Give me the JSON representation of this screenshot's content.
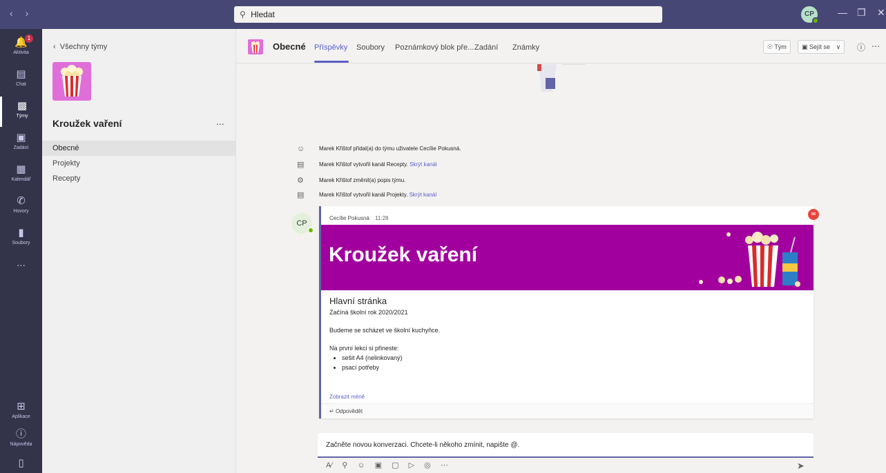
{
  "search": {
    "placeholder": "Hledat"
  },
  "user": {
    "initials": "CP"
  },
  "rail": {
    "notification_count": "1",
    "items": [
      {
        "label": "Aktivita",
        "icon": "bell-icon"
      },
      {
        "label": "Chat",
        "icon": "chat-icon"
      },
      {
        "label": "Týmy",
        "icon": "teams-icon"
      },
      {
        "label": "Zadání",
        "icon": "assignments-icon"
      },
      {
        "label": "Kalendář",
        "icon": "calendar-icon"
      },
      {
        "label": "Hovory",
        "icon": "phone-icon"
      },
      {
        "label": "Soubory",
        "icon": "file-icon"
      }
    ],
    "more": "...",
    "bottom": [
      {
        "label": "Aplikace",
        "icon": "apps-icon"
      },
      {
        "label": "Nápověda",
        "icon": "help-icon"
      }
    ]
  },
  "panel": {
    "back_label": "Všechny týmy",
    "team_name": "Kroužek vaření",
    "more": "...",
    "channels": [
      "Obecné",
      "Projekty",
      "Recepty"
    ]
  },
  "channel": {
    "name": "Obecné",
    "tabs": [
      "Příspěvky",
      "Soubory",
      "Poznámkový blok pře...",
      "Zadání",
      "Známky"
    ],
    "team_btn": "Tým",
    "meet_btn": "Sejít se"
  },
  "events": [
    {
      "icon": "user-add-icon",
      "text": "Marek Křištof přidal(a) do týmu uživatele Cecílie Pokusná.",
      "link": ""
    },
    {
      "icon": "channel-icon",
      "text": "Marek Křištof vytvořil kanál Recepty.",
      "link": "Skrýt kanál"
    },
    {
      "icon": "team-edit-icon",
      "text": "Marek Křištof změnil(a) popis týmu.",
      "link": ""
    },
    {
      "icon": "channel-icon",
      "text": "Marek Křištof vytvořil kanál Projekty.",
      "link": "Skrýt kanál"
    }
  ],
  "post": {
    "author": "Cecílie Pokusná",
    "time": "11:28",
    "avatar": "CP",
    "banner_title": "Kroužek vaření",
    "heading": "Hlavní stránka",
    "subheading": "Začíná školní rok 2020/2021",
    "para1": "Budeme se scházet ve školní kuchyňce.",
    "para2": "Na první lekci si přineste:",
    "list": [
      "sešit A4 (nelinkovaný)",
      "psací potřeby"
    ],
    "show_less": "Zobrazit méně",
    "reply": "Odpovědět"
  },
  "compose": {
    "placeholder": "Začněte novou konverzaci. Chcete-li někoho zmínit, napište @."
  },
  "colors": {
    "titlebar": "#464775",
    "rail": "#33344a",
    "accent": "#6264a7",
    "banner": "#a2009e"
  }
}
